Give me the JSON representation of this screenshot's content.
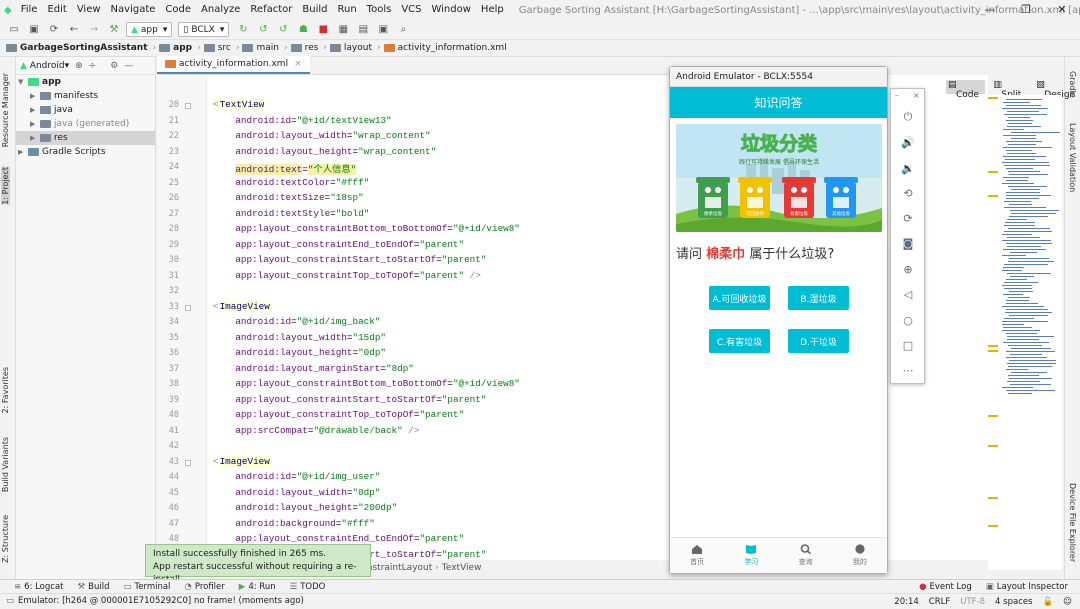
{
  "menu": [
    "File",
    "Edit",
    "View",
    "Navigate",
    "Code",
    "Analyze",
    "Refactor",
    "Build",
    "Run",
    "Tools",
    "VCS",
    "Window",
    "Help"
  ],
  "window_title": "Garbage Sorting Assistant [H:\\GarbageSortingAssistant] - ...\\app\\src\\main\\res\\layout\\activity_information.xml [app]",
  "window_controls": {
    "minimize": "—",
    "restore": "❐",
    "close": "✕"
  },
  "toolbar": {
    "run_config": "app",
    "device": "BCLX"
  },
  "breadcrumb": [
    "GarbageSortingAssistant",
    "app",
    "src",
    "main",
    "res",
    "layout",
    "activity_information.xml"
  ],
  "left_tabs": [
    "Resource Manager",
    "1: Project",
    "2: Favorites",
    "Build Variants",
    "Z: Structure"
  ],
  "right_tabs": [
    "Gradle",
    "Layout Validation",
    "Device File Explorer"
  ],
  "project": {
    "view_label": "Android",
    "tree": [
      {
        "label": "app",
        "level": 0,
        "bold": true
      },
      {
        "label": "manifests",
        "level": 1
      },
      {
        "label": "java",
        "level": 1
      },
      {
        "label": "java (generated)",
        "level": 1,
        "muted": true
      },
      {
        "label": "res",
        "level": 1,
        "selected": true
      },
      {
        "label": "Gradle Scripts",
        "level": 0
      }
    ]
  },
  "editor": {
    "tab": "activity_information.xml",
    "view_modes": [
      "Code",
      "Split",
      "Design"
    ],
    "lines": [
      {
        "n": 20,
        "t": "tag",
        "name": "TextView"
      },
      {
        "n": 21,
        "a": "android:id",
        "v": "\"@+id/textView13\""
      },
      {
        "n": 22,
        "a": "android:layout_width",
        "v": "\"wrap_content\""
      },
      {
        "n": 23,
        "a": "android:layout_height",
        "v": "\"wrap_content\""
      },
      {
        "n": 24,
        "a": "android:text",
        "v": "\"个人信息\"",
        "hl": true
      },
      {
        "n": 25,
        "a": "android:textColor",
        "v": "\"#fff\""
      },
      {
        "n": 26,
        "a": "android:textSize",
        "v": "\"18sp\""
      },
      {
        "n": 27,
        "a": "android:textStyle",
        "v": "\"bold\""
      },
      {
        "n": 28,
        "a": "app:layout_constraintBottom_toBottomOf",
        "v": "\"@+id/view8\""
      },
      {
        "n": 29,
        "a": "app:layout_constraintEnd_toEndOf",
        "v": "\"parent\""
      },
      {
        "n": 30,
        "a": "app:layout_constraintStart_toStartOf",
        "v": "\"parent\""
      },
      {
        "n": 31,
        "a": "app:layout_constraintTop_toTopOf",
        "v": "\"parent\"",
        "end": " />"
      },
      {
        "n": 32
      },
      {
        "n": 33,
        "t": "tag",
        "name": "ImageView"
      },
      {
        "n": 34,
        "a": "android:id",
        "v": "\"@+id/img_back\""
      },
      {
        "n": 35,
        "a": "android:layout_width",
        "v": "\"15dp\""
      },
      {
        "n": 36,
        "a": "android:layout_height",
        "v": "\"0dp\""
      },
      {
        "n": 37,
        "a": "android:layout_marginStart",
        "v": "\"8dp\""
      },
      {
        "n": 38,
        "a": "app:layout_constraintBottom_toBottomOf",
        "v": "\"@+id/view8\""
      },
      {
        "n": 39,
        "a": "app:layout_constraintStart_toStartOf",
        "v": "\"parent\""
      },
      {
        "n": 40,
        "a": "app:layout_constraintTop_toTopOf",
        "v": "\"parent\""
      },
      {
        "n": 41,
        "a": "app:srcCompat",
        "v": "\"@drawable/back\"",
        "end": " />"
      },
      {
        "n": 42
      },
      {
        "n": 43,
        "t": "tag",
        "name": "ImageView"
      },
      {
        "n": 44,
        "a": "android:id",
        "v": "\"@+id/img_user\""
      },
      {
        "n": 45,
        "a": "android:layout_width",
        "v": "\"0dp\""
      },
      {
        "n": 46,
        "a": "android:layout_height",
        "v": "\"200dp\""
      },
      {
        "n": 47,
        "a": "android:background",
        "v": "\"#fff\""
      },
      {
        "n": 48,
        "a": "app:layout_constraintEnd_toEndOf",
        "v": "\"parent\""
      },
      {
        "n": 49,
        "a": "app:layout_constraintStart_toStartOf",
        "v": "\"parent\""
      }
    ],
    "crumb": [
      "ConstraintLayout",
      "TextView"
    ]
  },
  "emulator": {
    "title": "Android Emulator - BCLX:5554",
    "app_title": "知识问答",
    "banner_title": "垃圾分类",
    "banner_subtitle": "践行可持续发展  倡导环保生活",
    "bins": [
      {
        "label": "厨余垃圾",
        "color": "#3f9e4d"
      },
      {
        "label": "可回收物",
        "color": "#f2c200"
      },
      {
        "label": "有害垃圾",
        "color": "#e53935"
      },
      {
        "label": "其他垃圾",
        "color": "#2196f3"
      }
    ],
    "question_prefix": "请问",
    "question_item": "棉柔巾",
    "question_suffix": "属于什么垃圾?",
    "answers": [
      "A.可回收垃圾",
      "B.湿垃圾",
      "C.有害垃圾",
      "D.干垃圾"
    ],
    "nav": [
      "首页",
      "学习",
      "查询",
      "我的"
    ],
    "panel_icons": [
      "power-icon",
      "volume-up-icon",
      "volume-down-icon",
      "rotate-left-icon",
      "rotate-right-icon",
      "camera-icon",
      "zoom-icon",
      "back-icon",
      "home-icon",
      "overview-icon",
      "more-icon"
    ]
  },
  "toast": {
    "line1": "Install successfully finished in 265 ms.",
    "line2": "App restart successful without requiring a re-install."
  },
  "bottom_tabs": [
    "6: Logcat",
    "Build",
    "Terminal",
    "Profiler",
    "4: Run",
    "TODO"
  ],
  "bottom_right_tabs": [
    "Event Log",
    "Layout Inspector"
  ],
  "status": {
    "message": "Emulator: [h264 @ 000001E7105292C0] no frame! (moments ago)",
    "position": "20:14",
    "line_sep": "CRLF",
    "encoding": "UTF-8",
    "indent": "4 spaces"
  }
}
